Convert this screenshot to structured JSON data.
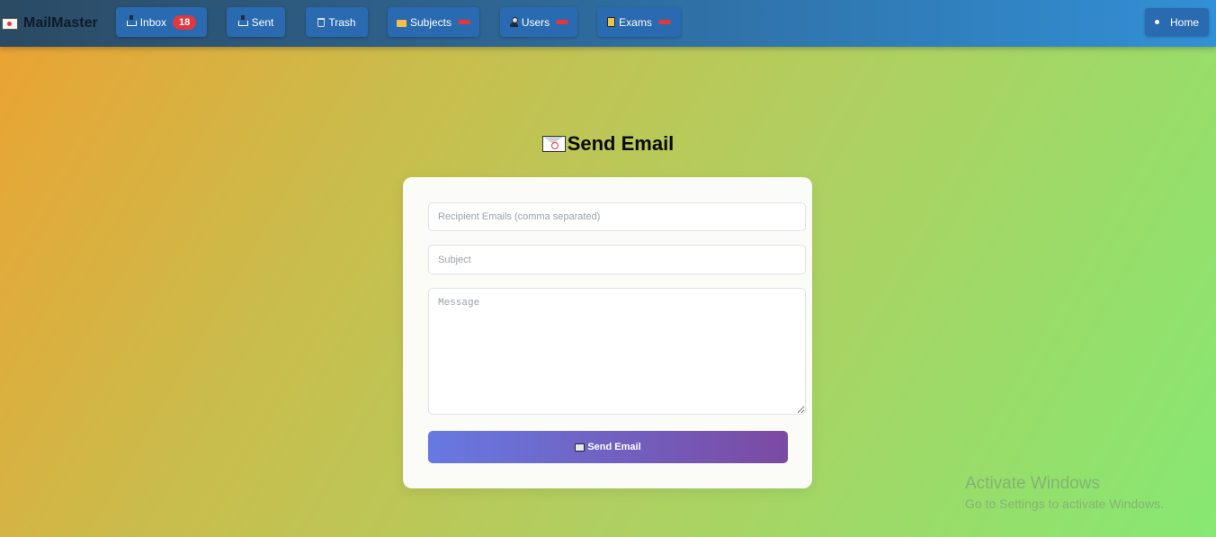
{
  "app": {
    "name": "MailMaster"
  },
  "nav": {
    "inbox": {
      "label": "Inbox",
      "count": "18"
    },
    "sent": {
      "label": "Sent"
    },
    "trash": {
      "label": "Trash"
    },
    "subjects": {
      "label": "Subjects"
    },
    "users": {
      "label": "Users"
    },
    "exams": {
      "label": "Exams"
    },
    "home": {
      "label": "Home"
    }
  },
  "page": {
    "title": "Send Email"
  },
  "form": {
    "recipients_placeholder": "Recipient Emails (comma separated)",
    "subject_placeholder": "Subject",
    "message_placeholder": "Message",
    "submit_label": "Send Email"
  },
  "watermark": {
    "title": "Activate Windows",
    "subtitle": "Go to Settings to activate Windows."
  },
  "colors": {
    "nav_button": "#2a6ab0",
    "badge": "#e0383e",
    "button_gradient_start": "#6779e2",
    "button_gradient_end": "#7b4aa2"
  }
}
